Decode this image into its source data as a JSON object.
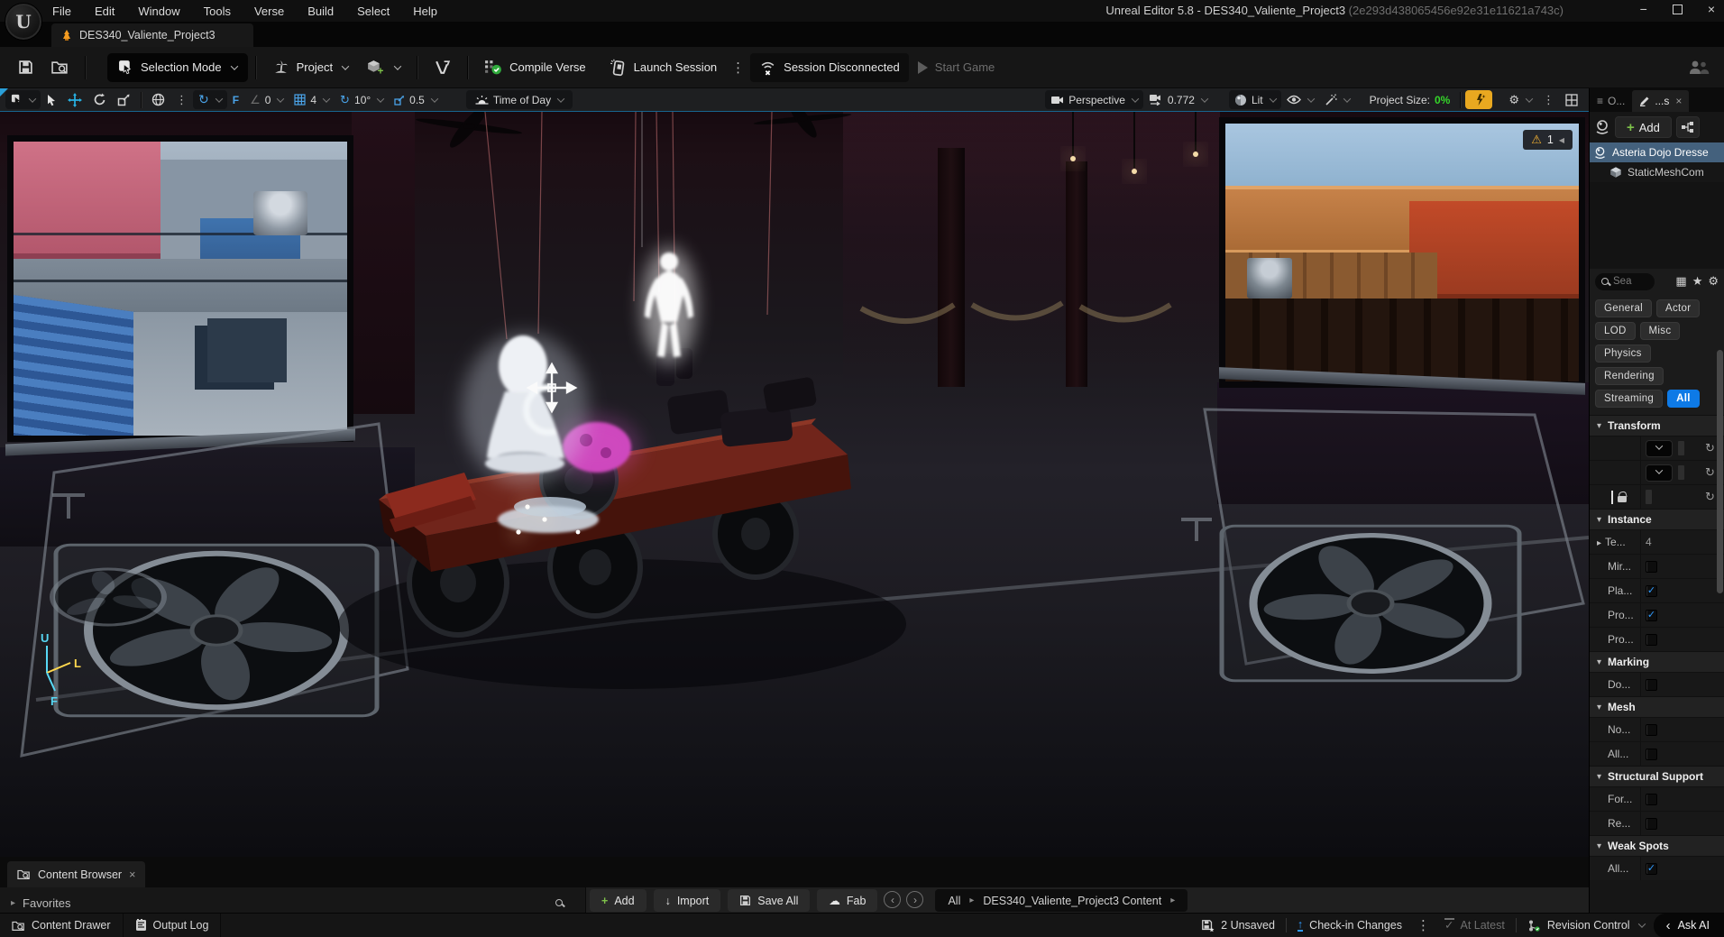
{
  "colors": {
    "accent_blue": "#0e7ae6",
    "selection_row_blue": "#44617d",
    "snap_icon_blue": "#4aa3e8",
    "move_tool_cyan": "#27b2e5",
    "project_size_green": "#35d62a",
    "warning_orange": "#f5b332",
    "live_edit_yellow": "#e9a820",
    "checkin_blue": "#2f9bff",
    "revision_green": "#37c837",
    "axis_cyan": "#57d8f5",
    "axis_yellow": "#ffd84e"
  },
  "icons": {
    "check": "✓",
    "close": "×",
    "kebab": "⋮",
    "star": "★",
    "gear": "⚙",
    "warning": "⚠",
    "reset": "↺",
    "small_left": "◀",
    "up_arrow": "↑",
    "down_arrow": "↓",
    "back_chevron": "‹",
    "fwd_chevron": "›",
    "plus": "+",
    "list": "≡",
    "grid_cells": "▦",
    "tri_right": "▸",
    "tri_down": "▾",
    "angle": "∠",
    "surface_snap": "F",
    "cloud": "☁",
    "minimize": "−"
  },
  "titlebar": {
    "menus": [
      "File",
      "Edit",
      "Window",
      "Tools",
      "Verse",
      "Build",
      "Select",
      "Help"
    ],
    "title": "Unreal Editor 5.8 - DES340_Valiente_Project3",
    "guid": "(2e293d438065456e92e31e11621a743c)"
  },
  "asset_tab": {
    "label": "DES340_Valiente_Project3"
  },
  "toolbar": {
    "selection_mode": "Selection Mode",
    "project": "Project",
    "compile_verse": "Compile Verse",
    "launch_session": "Launch Session",
    "session_status": "Session Disconnected",
    "start_game": "Start Game"
  },
  "viewport_toolbar": {
    "angle_snap": "0",
    "grid_snap": "4",
    "rotation_snap": "10°",
    "scale_snap": "0.5",
    "time_of_day": "Time of Day",
    "perspective": "Perspective",
    "camera_speed": "0.772",
    "view_mode": "Lit",
    "project_size_label": "Project Size:",
    "project_size_value": "0%"
  },
  "viewport": {
    "warning_count": "1",
    "axis": {
      "up": "U",
      "left": "L",
      "front": "F"
    }
  },
  "outliner": {
    "tab_outliner": "O...",
    "tab_details": "...s",
    "add_label": "Add",
    "actor_name": "Asteria Dojo Dresse",
    "component_name": "StaticMeshCom"
  },
  "details": {
    "search_placeholder": "Sea",
    "filters": [
      "General",
      "Actor",
      "LOD",
      "Misc",
      "Physics",
      "Rendering",
      "Streaming",
      "All"
    ],
    "active_filter": "All",
    "sections": {
      "transform": "Transform",
      "instance": "Instance",
      "marking": "Marking",
      "mesh": "Mesh",
      "structural": "Structural Support",
      "weak_spots": "Weak Spots"
    },
    "rows": {
      "te": {
        "label": "Te...",
        "value": "4"
      },
      "mir": "Mir...",
      "pla": "Pla...",
      "pro1": "Pro...",
      "pro2": "Pro...",
      "do": "Do...",
      "no": "No...",
      "all_mesh": "All...",
      "for": "For...",
      "re": "Re...",
      "all_weak": "All..."
    }
  },
  "content_browser": {
    "tab": "Content Browser",
    "favorites": "Favorites",
    "add": "Add",
    "import": "Import",
    "save_all": "Save All",
    "fab": "Fab",
    "crumb_all": "All",
    "crumb_path": "DES340_Valiente_Project3 Content"
  },
  "statusbar": {
    "content_drawer": "Content Drawer",
    "output_log": "Output Log",
    "unsaved": "2 Unsaved",
    "checkin": "Check-in Changes",
    "at_latest": "At Latest",
    "revision_control": "Revision Control",
    "ask_ai": "Ask AI"
  }
}
